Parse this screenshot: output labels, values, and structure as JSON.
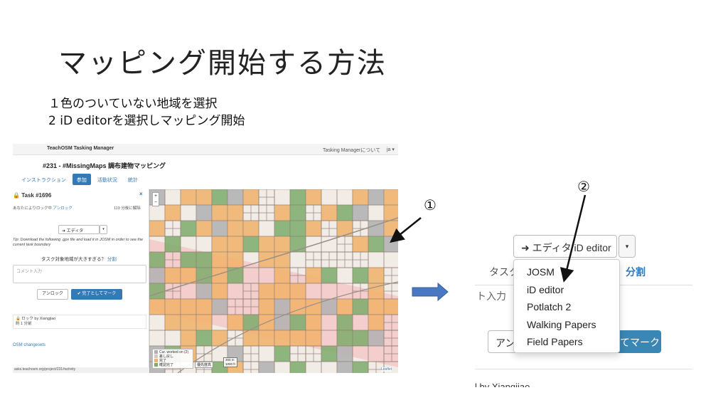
{
  "slide": {
    "title": "マッピング開始する方法",
    "steps": [
      "１色のついていない地域を選択",
      "2 iD editorを選択しマッピング開始"
    ],
    "marker_1": "①",
    "marker_2": "②"
  },
  "left_screenshot": {
    "topbar": {
      "brand": "TeachOSM Tasking Manager",
      "about": "Tasking Managerについて",
      "lang": "ja ▾"
    },
    "project_title": "#231 - #MissingMaps 調布建物マッピング",
    "tabs": [
      "インストラクション",
      "参加",
      "活動状況",
      "統計"
    ],
    "task": {
      "title": "Task #1696",
      "close": "×",
      "locked_by": "あなたによりロック中",
      "unlock_link": "アンロック",
      "time_left": "119 分後に解除",
      "editor_button": "➜ エディタ",
      "editor_caret": "▾",
      "tip": "Tip: Download the following .gpx file and load it in JOSM in order to see the current task boundary",
      "split_question": "タスク対象地域が大きすぎる？",
      "split_link": "分割",
      "comment_placeholder": "コメント入力",
      "unlock_button": "アンロック",
      "done_button": "✔ 完了としてマーク",
      "history_line1": "🔒 ロック by Xiangjiao",
      "history_line2": "約 1 分前",
      "osm_changesets": "OSM changesets",
      "status_url": "asks.teachosm.org/project/231#activity"
    },
    "map": {
      "zoom_in": "+",
      "zoom_out": "−",
      "legend": [
        "Cur. worked on (2)",
        "差し戻し",
        "完了",
        "確認完了"
      ],
      "scale": [
        "300 m",
        "1000 ft"
      ],
      "priority": "優先度高",
      "attribution": "Leaflet"
    },
    "colors": {
      "ready": "#f4efe9",
      "done": "#f1b26a",
      "validated": "#7cab6a",
      "locked": "#b0b0b0",
      "priority_area": "#f3c2c0",
      "accent": "#337ab7"
    }
  },
  "right_screenshot": {
    "editor_button": "➜ エディタ iD editor",
    "caret": "▾",
    "tab_fragment": "タスク",
    "split_fragment": "分割",
    "input_fragment": "ト入力",
    "unlock_fragment": "アン",
    "done_fragment": "てマーク",
    "lock_fragment": "l by Xiangjiao",
    "menu": [
      "JOSM",
      "iD editor",
      "Potlatch 2",
      "Walking Papers",
      "Field Papers"
    ]
  },
  "arrow_color": "#4a78c2"
}
